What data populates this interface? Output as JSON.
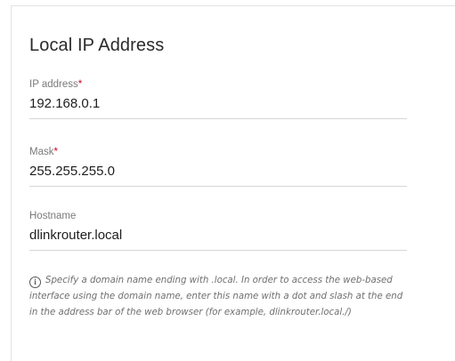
{
  "section": {
    "title": "Local IP Address"
  },
  "fields": {
    "ip": {
      "label": "IP address",
      "required_mark": "*",
      "value": "192.168.0.1"
    },
    "mask": {
      "label": "Mask",
      "required_mark": "*",
      "value": "255.255.255.0"
    },
    "hostname": {
      "label": "Hostname",
      "value": "dlinkrouter.local"
    }
  },
  "hint": {
    "icon": "info-icon",
    "icon_glyph": "i",
    "text": "Specify a domain name ending with .local. In order to access the web-based interface using the domain name, enter this name with a dot and slash at the end in the address bar of the web browser (for example, dlinkrouter.local./)"
  },
  "colors": {
    "required": "#d0011b",
    "label": "#7a7a7a",
    "underline": "#d6d6d6"
  }
}
